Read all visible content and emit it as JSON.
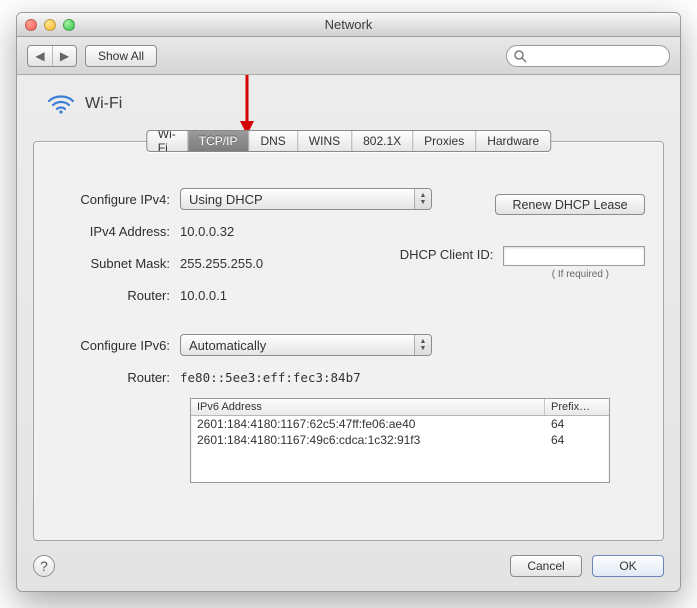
{
  "window": {
    "title": "Network"
  },
  "toolbar": {
    "show_all": "Show All",
    "search_placeholder": ""
  },
  "heading": {
    "name": "Wi-Fi"
  },
  "tabs": {
    "items": [
      "Wi-Fi",
      "TCP/IP",
      "DNS",
      "WINS",
      "802.1X",
      "Proxies",
      "Hardware"
    ],
    "active_index": 1
  },
  "ipv4": {
    "configure_label": "Configure IPv4:",
    "configure_value": "Using DHCP",
    "address_label": "IPv4 Address:",
    "address_value": "10.0.0.32",
    "subnet_label": "Subnet Mask:",
    "subnet_value": "255.255.255.0",
    "router_label": "Router:",
    "router_value": "10.0.0.1",
    "renew_label": "Renew DHCP Lease",
    "dhcp_client_id_label": "DHCP Client ID:",
    "dhcp_client_id_value": "",
    "if_required": "( If required )"
  },
  "ipv6": {
    "configure_label": "Configure IPv6:",
    "configure_value": "Automatically",
    "router_label": "Router:",
    "router_value": "fe80::5ee3:eff:fec3:84b7",
    "table": {
      "headers": [
        "IPv6 Address",
        "Prefix…"
      ],
      "rows": [
        {
          "address": "2601:184:4180:1167:62c5:47ff:fe06:ae40",
          "prefix": "64"
        },
        {
          "address": "2601:184:4180:1167:49c6:cdca:1c32:91f3",
          "prefix": "64"
        }
      ]
    }
  },
  "footer": {
    "cancel": "Cancel",
    "ok": "OK"
  },
  "colors": {
    "arrow": "#d40000"
  }
}
